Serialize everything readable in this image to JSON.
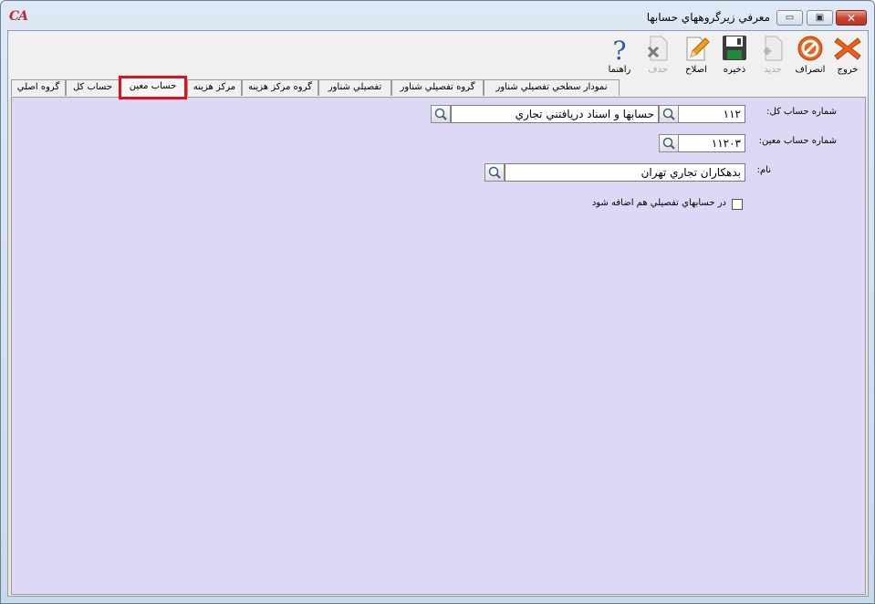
{
  "window": {
    "logo": "CA",
    "title": "معرفي زيرگروههاي حسابها",
    "buttons": {
      "minimize": "▭",
      "maximize": "▣",
      "close": "✕"
    }
  },
  "toolbar": {
    "items": [
      {
        "label": "خروج",
        "icon": "exit-x-icon",
        "enabled": true
      },
      {
        "label": "انصراف",
        "icon": "cancel-icon",
        "enabled": true
      },
      {
        "label": "جديد",
        "icon": "new-document-icon",
        "enabled": false
      },
      {
        "label": "ذخيره",
        "icon": "save-disk-icon",
        "enabled": true
      },
      {
        "label": "اصلاح",
        "icon": "edit-pencil-icon",
        "enabled": true
      },
      {
        "label": "حذف",
        "icon": "delete-icon",
        "enabled": false
      },
      {
        "label": "راهنما",
        "icon": "help-question-icon",
        "enabled": true
      }
    ]
  },
  "tabs": {
    "items": [
      {
        "label": "گروه اصلي"
      },
      {
        "label": "حساب کل"
      },
      {
        "label": "حساب معين"
      },
      {
        "label": "مرکز هزينه"
      },
      {
        "label": "گروه مرکز هزينه"
      },
      {
        "label": "تفصيلي شناور"
      },
      {
        "label": "گروه تفصيلي شناور"
      },
      {
        "label": "نمودار سطحي تفصيلي شناور"
      }
    ],
    "active": "حساب معين"
  },
  "form": {
    "general_account": {
      "label": "شماره حساب کل:",
      "code": "۱۱۲",
      "name": "حسابها و اسناد دريافتني تجاري"
    },
    "subsidiary_account": {
      "label": "شماره حساب معين:",
      "code": "۱۱۲۰۳"
    },
    "name": {
      "label": "نام:",
      "value": "بدهکاران تجاري تهران"
    },
    "add_to_detail": {
      "label": "در حسابهاي تفصيلي هم اضافه شود",
      "checked": false
    }
  },
  "colors": {
    "panel": "#dcd8f6",
    "active_tab_border": "#e0101c",
    "logo": "#c0262c"
  }
}
